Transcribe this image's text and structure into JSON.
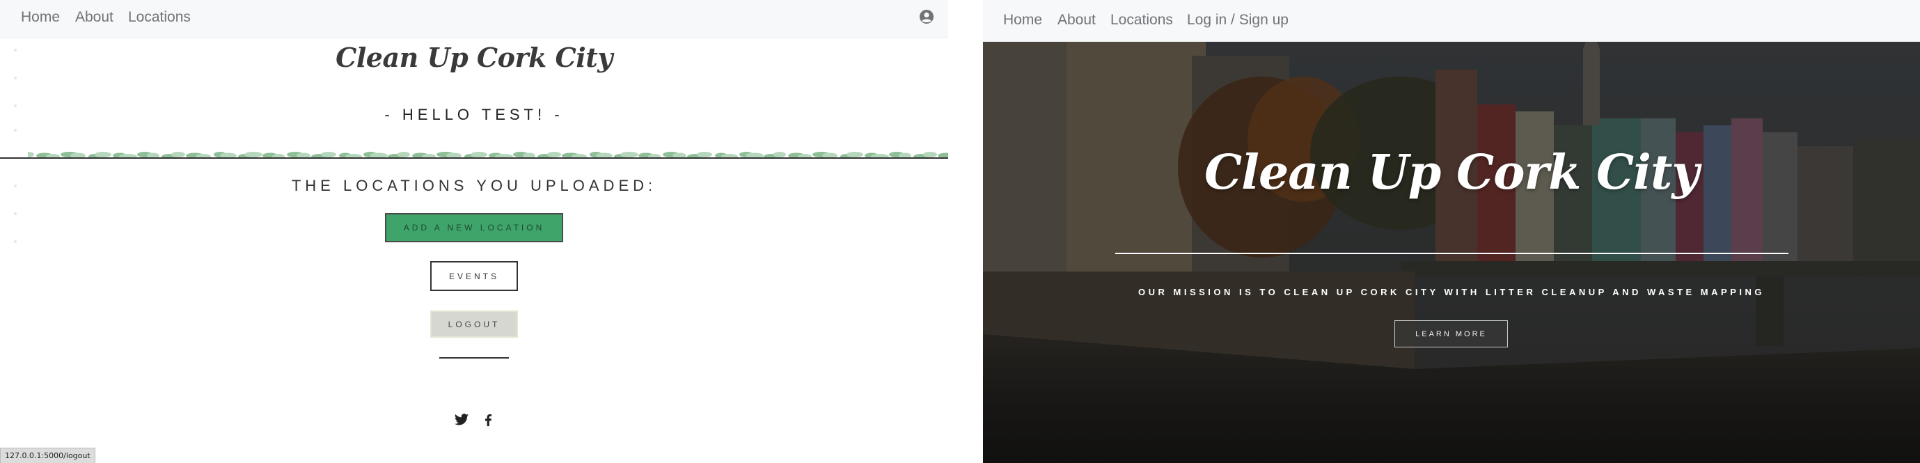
{
  "left": {
    "nav": {
      "items": [
        "Home",
        "About",
        "Locations"
      ],
      "user_icon": "user-circle-icon"
    },
    "logo": "Clean Up Cork City",
    "greeting": "- HELLO TEST! -",
    "section_title": "THE LOCATIONS YOU UPLOADED:",
    "buttons": {
      "add_location": "ADD A NEW LOCATION",
      "events": "EVENTS",
      "logout": "LOGOUT"
    },
    "social": [
      "twitter-icon",
      "facebook-icon"
    ],
    "status_url": "127.0.0.1:5000/logout",
    "colors": {
      "add_button": "#3fa46a",
      "logout_button": "#d7d7d2",
      "leaf_green": "#6aaa78"
    }
  },
  "right": {
    "nav": {
      "items": [
        "Home",
        "About",
        "Locations",
        "Log in / Sign up"
      ]
    },
    "hero": {
      "title": "Clean Up Cork City",
      "mission": "OUR MISSION IS TO CLEAN UP CORK CITY WITH LITTER CLEANUP AND WASTE MAPPING",
      "cta": "LEARN MORE"
    }
  }
}
